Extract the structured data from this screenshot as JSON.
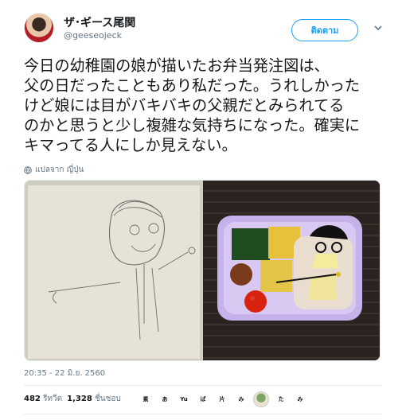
{
  "user": {
    "name": "ザ･ギース尾関",
    "handle": "@geeseojeck",
    "follow_label": "ติดตาม"
  },
  "tweet": {
    "text": "今日の幼稚園の娘が描いたお弁当発注図は、\n父の日だったこともあり私だった。うれしかった\nけど娘には目がバキバキの父親だとみられてる\nのかと思うと少し複雑な気持ちになった。確実に\nキマってる人にしか見えない。",
    "translate_label": "แปลจาก ญี่ปุ่น",
    "timestamp": "20:35 - 22 มิ.ย. 2560"
  },
  "stats": {
    "retweet_count": "482",
    "retweet_label": "รีทวีต",
    "like_count": "1,328",
    "like_label": "ชื่นชอบ"
  },
  "likers": [
    "素",
    "あ",
    "Yu",
    "ぱ",
    "片",
    "み",
    "",
    "た",
    "み"
  ],
  "colors": {
    "accent": "#1da1f2",
    "muted": "#657786",
    "border": "#e6ecf0"
  }
}
